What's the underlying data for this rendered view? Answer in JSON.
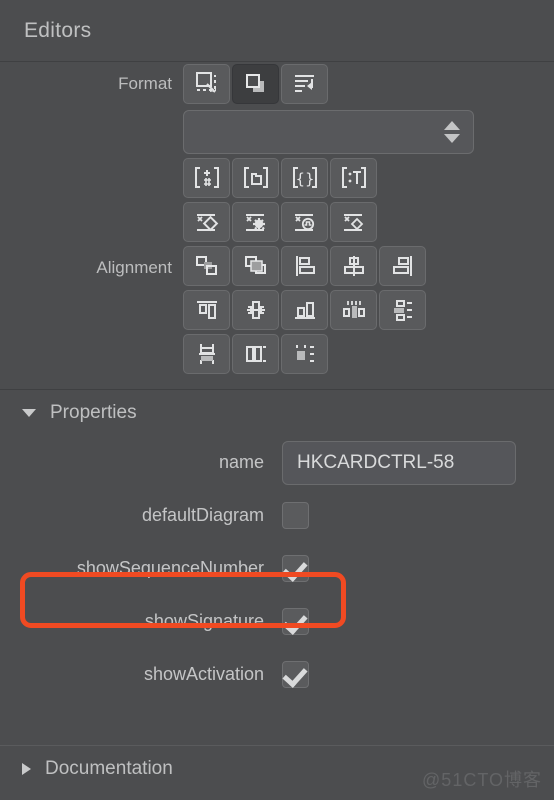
{
  "header": {
    "title": "Editors"
  },
  "format": {
    "label": "Format",
    "buttons": [
      {
        "name": "select-shape-icon",
        "active": false
      },
      {
        "name": "bring-to-front-icon",
        "active": true
      },
      {
        "name": "align-text-icon",
        "active": false
      }
    ],
    "combo": {
      "value": "",
      "placeholder": ""
    },
    "row2": [
      {
        "name": "insert-attribute-icon"
      },
      {
        "name": "insert-folder-icon"
      },
      {
        "name": "insert-braces-icon"
      },
      {
        "name": "insert-text-icon"
      }
    ],
    "row3": [
      {
        "name": "delete-diamond-icon"
      },
      {
        "name": "delete-gear-icon"
      },
      {
        "name": "delete-signal-icon"
      },
      {
        "name": "delete-small-diamond-icon"
      }
    ]
  },
  "alignment": {
    "label": "Alignment",
    "row1": [
      {
        "name": "send-backward-icon"
      },
      {
        "name": "bring-forward-icon"
      },
      {
        "name": "align-left-icon"
      },
      {
        "name": "align-center-icon"
      },
      {
        "name": "align-right-icon"
      }
    ],
    "row2": [
      {
        "name": "align-top-icon"
      },
      {
        "name": "align-middle-icon"
      },
      {
        "name": "align-bottom-icon"
      },
      {
        "name": "distribute-horizontal-icon"
      },
      {
        "name": "distribute-vertical-icon"
      }
    ],
    "row3": [
      {
        "name": "same-height-icon"
      },
      {
        "name": "same-width-icon"
      },
      {
        "name": "same-size-icon"
      }
    ]
  },
  "properties": {
    "title": "Properties",
    "expanded": true,
    "fields": [
      {
        "label": "name",
        "type": "text",
        "value": "HKCARDCTRL-58"
      },
      {
        "label": "defaultDiagram",
        "type": "checkbox",
        "checked": false
      },
      {
        "label": "showSequenceNumber",
        "type": "checkbox",
        "checked": true,
        "highlighted": true
      },
      {
        "label": "showSignature",
        "type": "checkbox",
        "checked": true
      },
      {
        "label": "showActivation",
        "type": "checkbox",
        "checked": true
      }
    ]
  },
  "documentation": {
    "title": "Documentation",
    "expanded": false
  },
  "watermark": {
    "text": "@51CTO博客"
  },
  "colors": {
    "panel_bg": "#4c4d4f",
    "button_bg": "#595a5c",
    "button_active_bg": "#3d3e40",
    "text": "#c4c5c6",
    "highlight": "#f04a22"
  }
}
